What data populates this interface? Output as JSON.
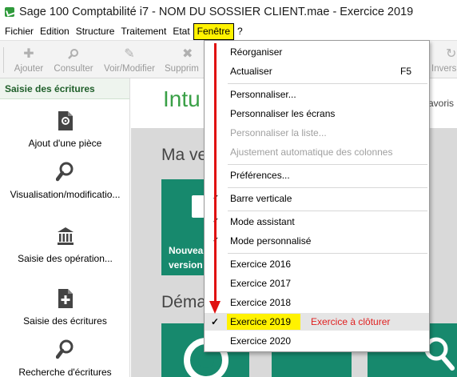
{
  "window": {
    "title": "Sage 100 Comptabilité i7 - NOM DU SOSSIER CLIENT.mae - Exercice 2019"
  },
  "menubar": [
    "Fichier",
    "Edition",
    "Structure",
    "Traitement",
    "Etat",
    "Fenêtre",
    "?"
  ],
  "toolbar": {
    "ajouter": "Ajouter",
    "consulter": "Consulter",
    "voir": "Voir/Modifier",
    "supprimer": "Supprim",
    "inverser": "Inversi"
  },
  "sidebar": {
    "heading": "Saisie des écritures",
    "items": [
      {
        "label": "Ajout d'une pièce",
        "icon": "gear-document-icon"
      },
      {
        "label": "Visualisation/modificatio...",
        "icon": "magnifier-icon"
      },
      {
        "label": "Saisie des opération...",
        "icon": "bank-icon"
      },
      {
        "label": "Saisie des écritures",
        "icon": "add-document-icon"
      },
      {
        "label": "Recherche d'écritures",
        "icon": "magnifier-icon"
      }
    ]
  },
  "content": {
    "brand": "Intu",
    "favoris": "avoris",
    "section1": "Ma ve",
    "section2": "Déma",
    "tile_text_1": "Nouvea",
    "tile_text_2": "version"
  },
  "dropdown": {
    "items": [
      {
        "label": "Réorganiser"
      },
      {
        "label": "Actualiser",
        "shortcut": "F5"
      },
      {
        "label": "Personnaliser..."
      },
      {
        "label": "Personnaliser les écrans"
      },
      {
        "label": "Personnaliser la liste...",
        "disabled": true
      },
      {
        "label": "Ajustement automatique des colonnes",
        "disabled": true
      },
      {
        "label": "Préférences..."
      },
      {
        "label": "Barre verticale"
      },
      {
        "label": "Mode assistant"
      },
      {
        "label": "Mode personnalisé"
      },
      {
        "label": "Exercice 2016"
      },
      {
        "label": "Exercice 2017"
      },
      {
        "label": "Exercice 2018"
      },
      {
        "label": "Exercice 2019",
        "checked": true
      },
      {
        "label": "Exercice 2020"
      }
    ],
    "annotation": "Exercice à clôturer"
  },
  "colors": {
    "highlight": "#fff200",
    "annotation": "#e02020",
    "brand_green": "#3aa047",
    "tile": "#17896d"
  }
}
